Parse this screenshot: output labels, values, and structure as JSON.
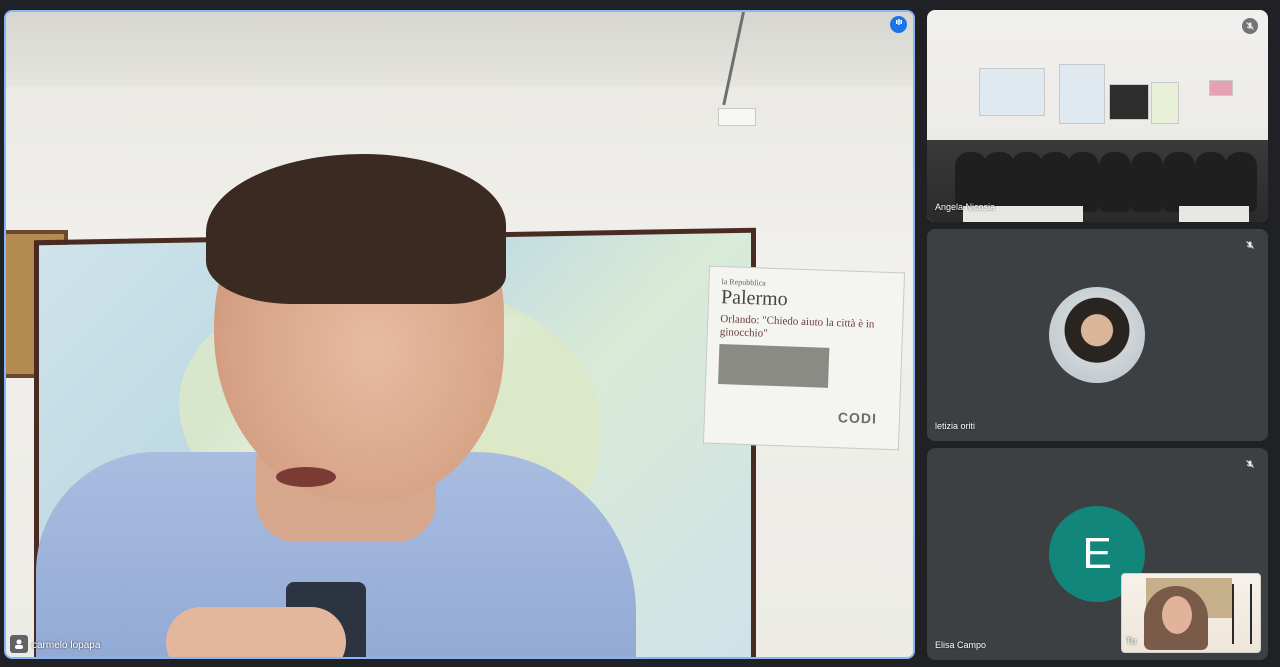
{
  "main": {
    "speaker_name": "carmelo lopapa",
    "newspaper": {
      "brand": "la Repubblica",
      "city": "Palermo",
      "headline": "Orlando: \"Chiedo aiuto la città è in ginocchio\"",
      "logo": "CODI"
    }
  },
  "participants": [
    {
      "name": "Angela Nicosia",
      "muted": true,
      "type": "video"
    },
    {
      "name": "letizia oriti",
      "muted": true,
      "type": "avatar-photo"
    },
    {
      "name": "Elisa Campo",
      "muted": true,
      "type": "avatar-letter",
      "initial": "E",
      "avatar_color": "#12867a"
    }
  ],
  "self_view": {
    "label": "Tu"
  },
  "colors": {
    "background": "#202124",
    "active_border": "#8ab4f8",
    "speaking_badge": "#1a73e8"
  },
  "icons": {
    "speaking": "speaking-indicator-icon",
    "mic_off": "mic-off-icon",
    "person": "person-icon"
  }
}
